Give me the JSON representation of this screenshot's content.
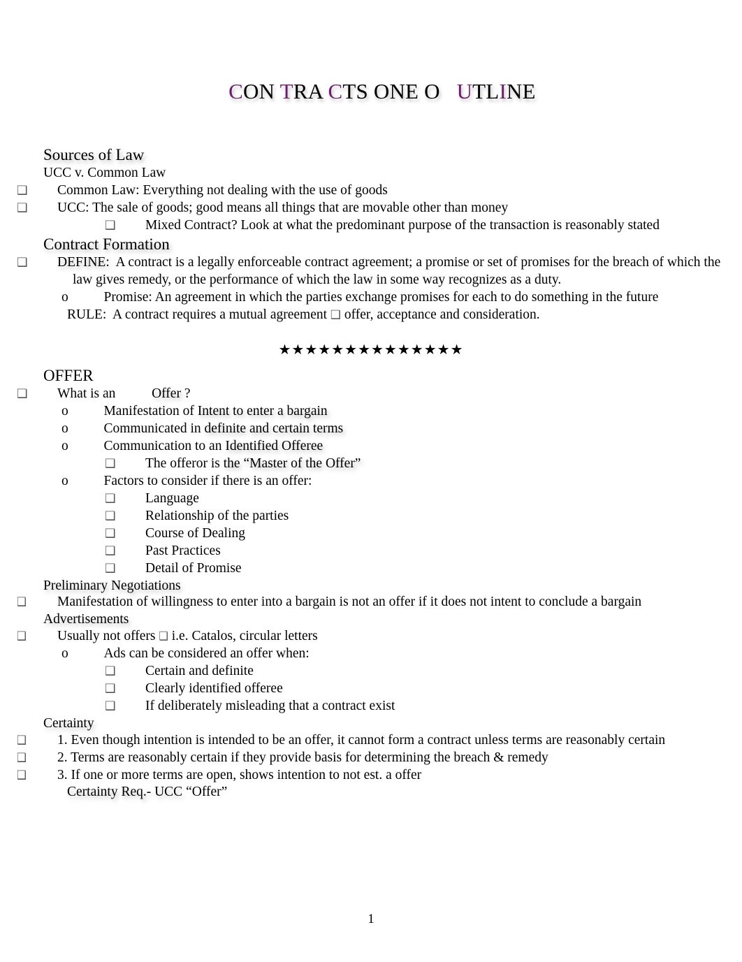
{
  "document": {
    "title_segments": [
      {
        "t": "C",
        "hl": true
      },
      {
        "t": "ON ",
        "hl": false
      },
      {
        "t": "T",
        "hl": true
      },
      {
        "t": "RA ",
        "hl": false
      },
      {
        "t": "C",
        "hl": true
      },
      {
        "t": "TS ONE O   ",
        "hl": false
      },
      {
        "t": "U",
        "hl": true
      },
      {
        "t": "TL",
        "hl": false
      },
      {
        "t": "I",
        "hl": true
      },
      {
        "t": "NE",
        "hl": false
      }
    ],
    "title_plain": "CONTRACTS ONE OUTLINE",
    "accent_color": "#6d1b6d",
    "page_number": "1",
    "star_divider": "★★★★★★★★★★★★★★",
    "bullet_glyph": "❑",
    "bullet_glyph_italic": "❑",
    "sub_bullet_glyph": "o",
    "inline_tofu": "❑"
  },
  "sections": {
    "sources_of_law": {
      "heading": "Sources of Law",
      "subheading": "UCC v. Common Law",
      "items": [
        {
          "label": "Common Law:",
          "gap": "     ",
          "text": "Everything not dealing with the use of goods"
        },
        {
          "label": "UCC:",
          "gap": "  ",
          "text": "The sale of goods; good means all things that are movable other than money"
        }
      ],
      "nested": [
        {
          "label": "Mixed Contract?",
          "gap": "        ",
          "text": "Look at what the predominant purpose of the transaction is reasonably stated"
        }
      ]
    },
    "contract_formation": {
      "heading": "Contract Formation",
      "define": {
        "label": "DEFINE:",
        "text": "A contract is a legally enforceable contract agreement; a promise or set of promises for the breach of which the law gives remedy, or the performance of which the law in some way recognizes as a duty."
      },
      "promise": {
        "label": "Promise:",
        "text": "An agreement in which the parties exchange promises for each to do something in the future"
      },
      "rule": {
        "label": "RULE:",
        "text_before": "A contract requires a mutual agreement",
        "text_after": "offer, acceptance and consideration."
      }
    },
    "offer": {
      "heading": "OFFER",
      "question_pre": "What is an ",
      "question_word": "Offer",
      "question_post": " ?",
      "elements": [
        {
          "pre": "Manifestation of ",
          "gap": "     ",
          "emph": "Intent to enter a bargain"
        },
        {
          "pre": "Communicated in ",
          "gap": "      ",
          "emph": "definite and certain terms"
        },
        {
          "pre": "Communication to an ",
          "gap": "      ",
          "emph": "Identified Offeree"
        }
      ],
      "master_line": {
        "pre": "The offeror is ",
        "gap": "    ",
        "emph": "the “Master of the Offer”"
      },
      "factors_heading": "Factors to consider if there is an offer:",
      "factors": [
        "Language",
        "Relationship of the parties",
        "Course of Dealing",
        "Past Practices",
        "Detail of Promise"
      ]
    },
    "preliminary_negotiations": {
      "heading": "Preliminary Negotiations",
      "items": [
        "Manifestation of willingness to enter into a bargain is not an offer if it does not intent to conclude a bargain"
      ]
    },
    "advertisements": {
      "heading": "Advertisements",
      "item_pre": "Usually not offers",
      "item_post": "i.e. Catalos, circular letters",
      "sub_heading": "Ads can be considered an offer when:",
      "sub_items": [
        "Certain and definite",
        "Clearly identified offeree",
        "If deliberately misleading that a contract exist"
      ]
    },
    "certainty": {
      "heading": "Certainty",
      "items": [
        "1. Even though intention is intended to be an offer, it cannot form a contract unless terms are reasonably certain",
        "2. Terms are reasonably certain if they provide basis for determining the breach & remedy",
        "3. If one or more terms are open, shows intention to not est. a offer"
      ],
      "footer_pre": "Certainty Req.- UCC",
      "footer_gap": "      ",
      "footer_post": "“Offer”"
    }
  }
}
